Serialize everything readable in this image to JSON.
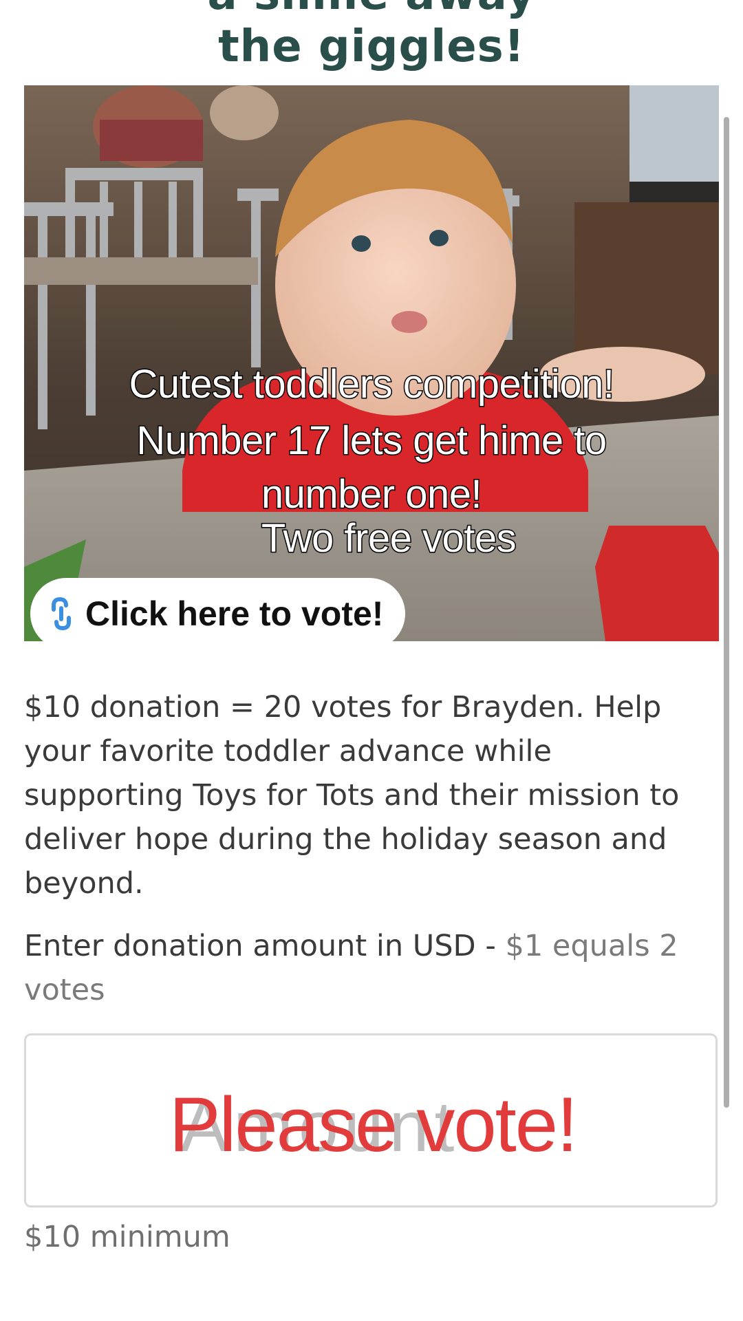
{
  "heading": {
    "line_partial": "a smile away",
    "line": "the giggles!"
  },
  "photo": {
    "overlay_lines": [
      "Cutest toddlers competition!",
      "Number 17 lets get hime to",
      "number one!",
      "Two free votes"
    ],
    "vote_button_label": "Click here to vote!",
    "vote_button_icon": "link-icon"
  },
  "description": "$10 donation = 20 votes for Brayden. Help your favorite toddler advance while supporting Toys for Tots and their mission to deliver hope during the holiday season and beyond.",
  "amount_field": {
    "label_main": "Enter donation amount in USD - ",
    "label_muted": "$1 equals 2 votes",
    "ghost_placeholder": "Amount",
    "sticker_text": "Please vote!",
    "hint": "$10 minimum"
  },
  "colors": {
    "heading": "#2a4e4a",
    "sticker": "#e23b3b",
    "link_icon": "#3b8fe0"
  }
}
